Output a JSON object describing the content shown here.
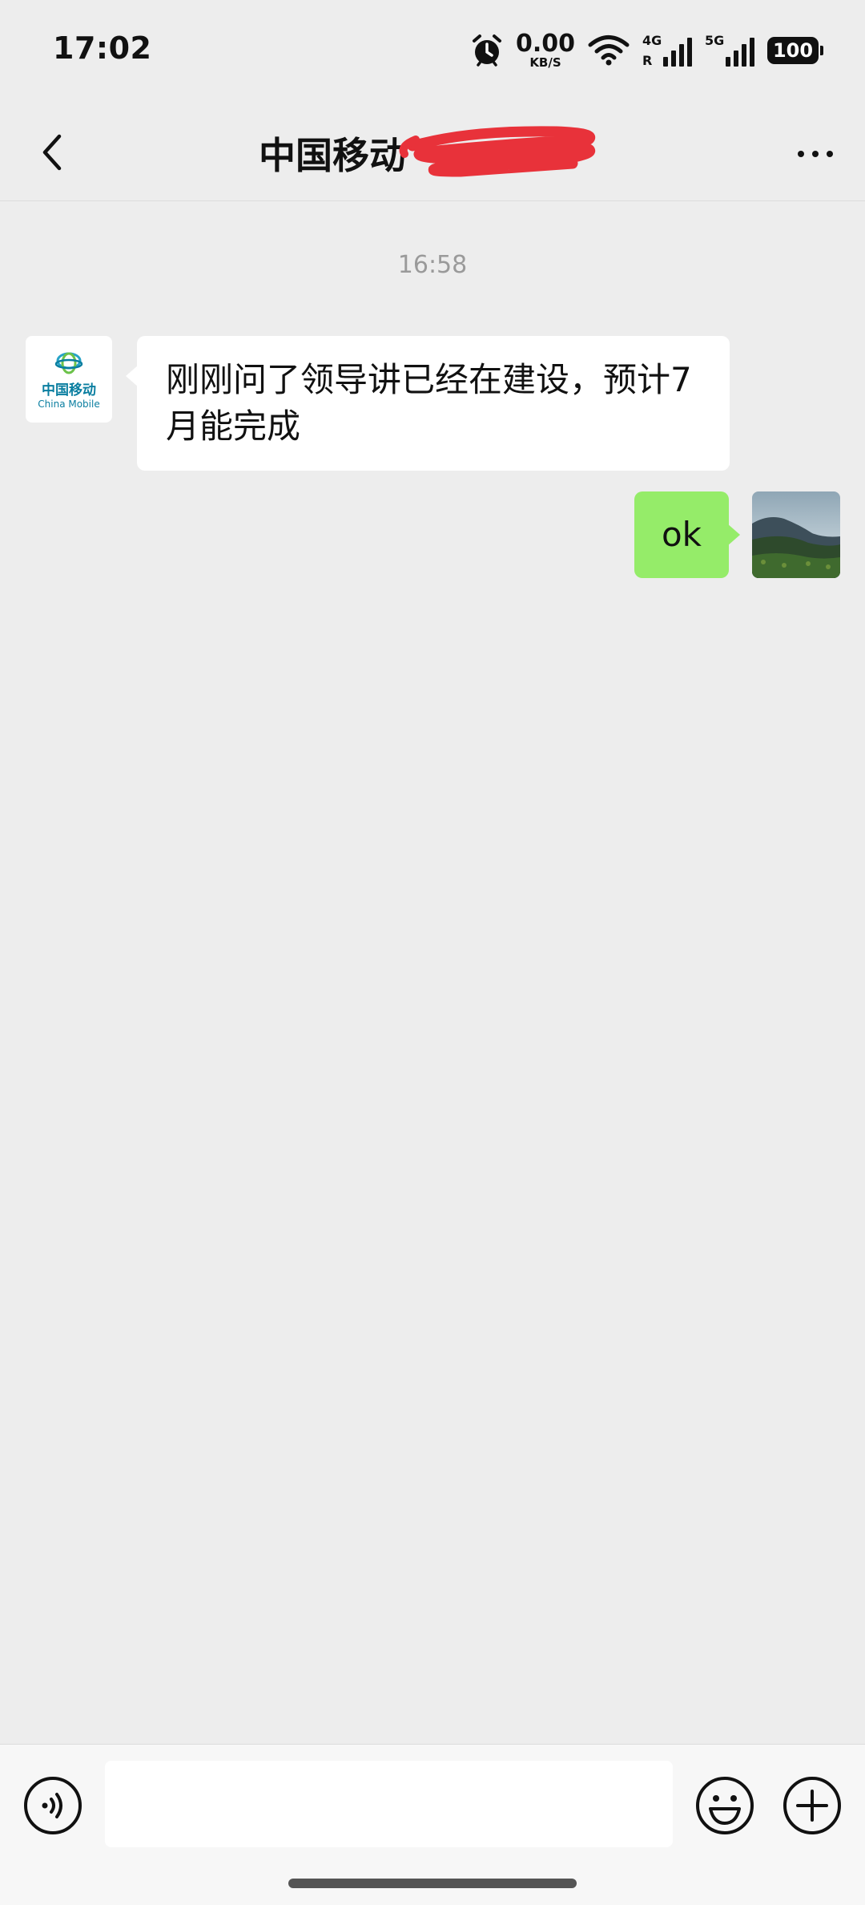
{
  "status_bar": {
    "time": "17:02",
    "net_speed_value": "0.00",
    "net_speed_unit": "KB/S",
    "signal1_tag": "4G",
    "signal1_roaming": "R",
    "signal2_tag": "5G",
    "battery": "100",
    "icons": [
      "alarm-icon",
      "wifi-icon",
      "signal-icon",
      "signal-icon",
      "battery-icon"
    ]
  },
  "header": {
    "title": "中国移动",
    "back_icon": "chevron-left-icon",
    "more_icon": "more-dots-icon"
  },
  "chat": {
    "timestamp": "16:58",
    "messages": [
      {
        "side": "left",
        "avatar_text_cn": "中国移动",
        "avatar_text_en": "China Mobile",
        "text": "刚刚问了领导讲已经在建设，预计7月能完成"
      },
      {
        "side": "right",
        "text": "ok"
      }
    ]
  },
  "input_bar": {
    "value": "",
    "placeholder": "",
    "icons": [
      "voice-icon",
      "emoji-icon",
      "plus-icon"
    ]
  },
  "colors": {
    "background": "#ededed",
    "sent_bubble": "#95ec69",
    "received_bubble": "#ffffff",
    "redaction": "#e8323a"
  }
}
